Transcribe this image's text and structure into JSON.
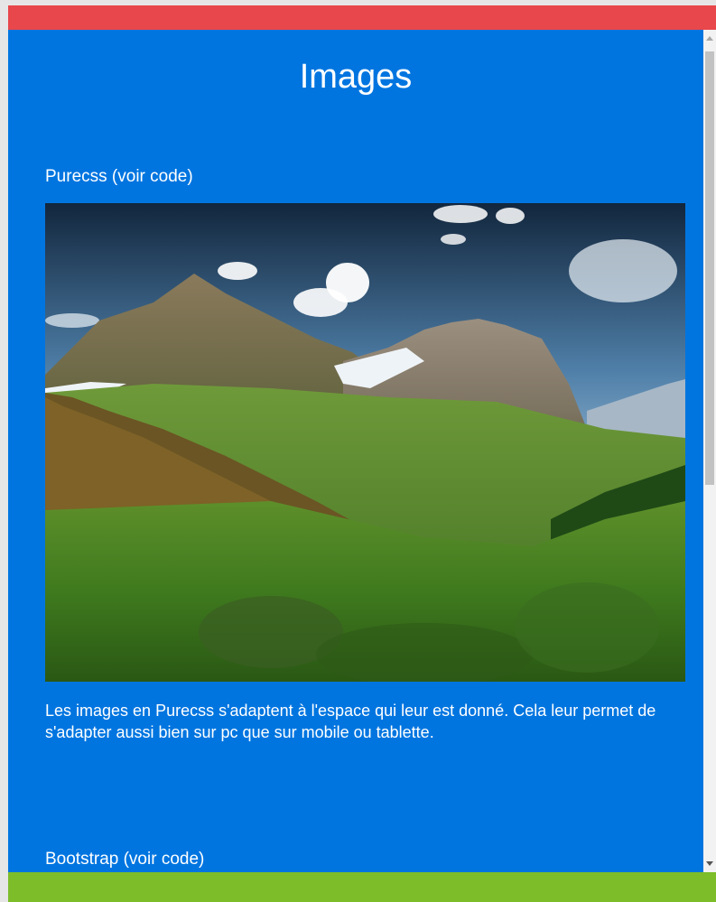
{
  "page": {
    "title": "Images"
  },
  "sections": [
    {
      "name": "Purecss",
      "link_text": "(voir code)",
      "description": "Les images en Purecss s'adaptent à l'espace qui leur est donné. Cela leur permet de s'adapter aussi bien sur pc que sur mobile ou tablette."
    },
    {
      "name": "Bootstrap",
      "link_text": "(voir code)"
    }
  ],
  "colors": {
    "top_bar": "#e8474b",
    "content_background": "#0075e0",
    "bottom_bar": "#7dbd2a",
    "text": "#ffffff"
  },
  "icons": {
    "scroll_up": "triangle-up",
    "scroll_down": "triangle-down"
  }
}
